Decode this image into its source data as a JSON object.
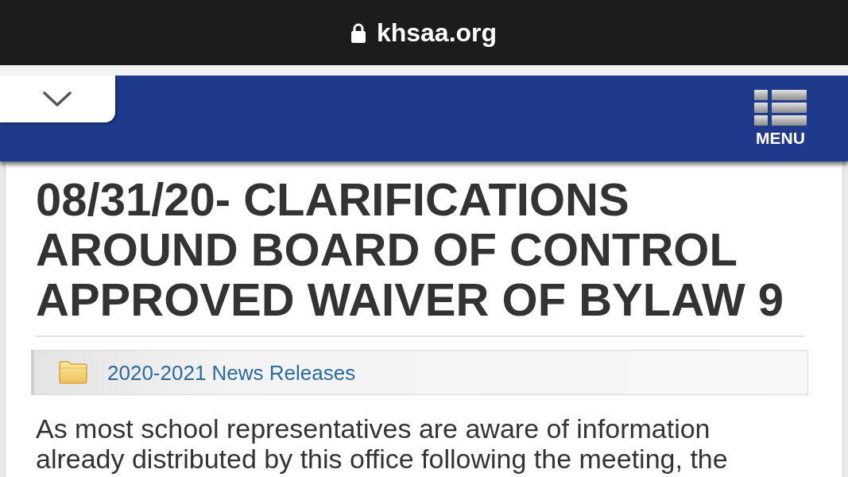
{
  "browser_bar": {
    "url": "khsaa.org",
    "secure": true
  },
  "site_header": {
    "menu_label": "MENU"
  },
  "article": {
    "title": "08/31/20- CLARIFICATIONS AROUND BOARD OF CONTROL APPROVED WAIVER OF BYLAW 9",
    "category_link": "2020-2021 News Releases",
    "body": "As most school representatives are aware of information already distributed by this office following the meeting, the"
  }
}
